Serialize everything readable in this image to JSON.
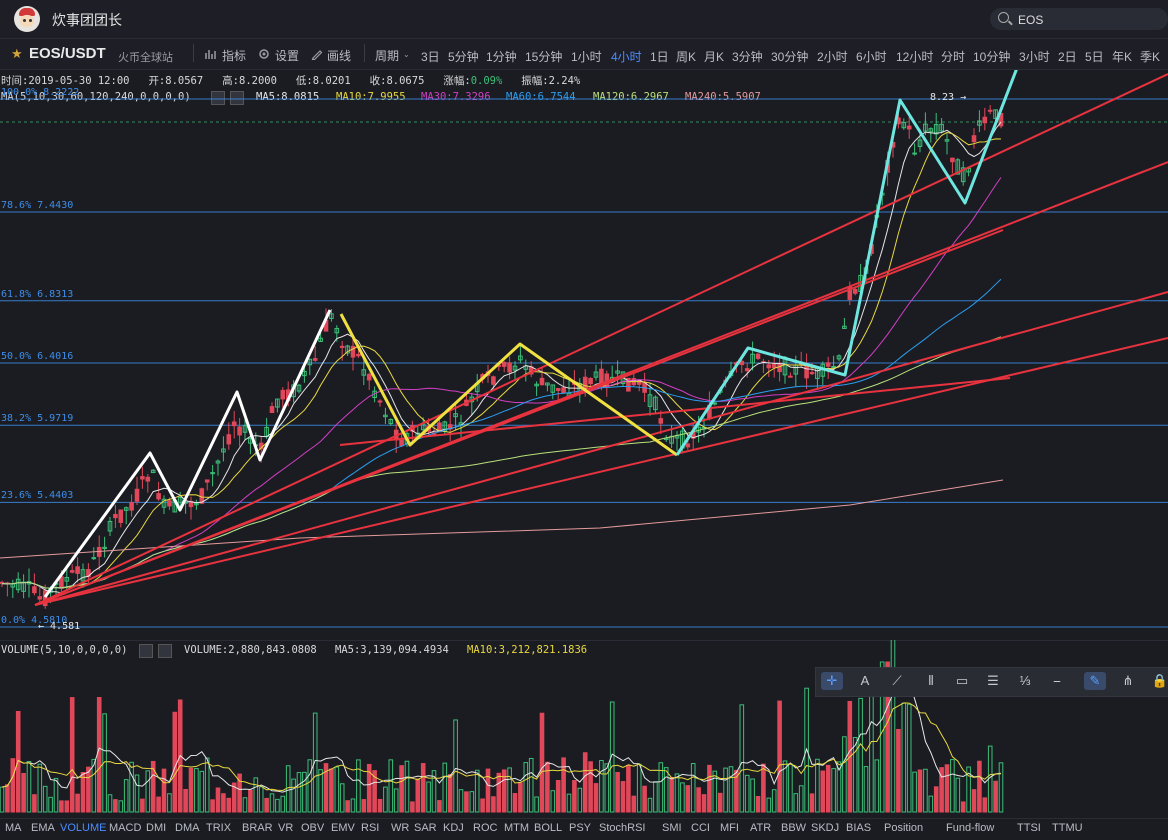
{
  "app": {
    "title": "炊事团团长"
  },
  "search": {
    "value": "EOS"
  },
  "toolbar": {
    "pair": "EOS/USDT",
    "exchange": "火币全球站",
    "indicator_label": "指标",
    "settings_label": "设置",
    "draw_label": "画线",
    "period_label": "周期",
    "periods": [
      "3日",
      "5分钟",
      "1分钟",
      "15分钟",
      "1小时",
      "4小时",
      "1日",
      "周K",
      "月K",
      "3分钟",
      "30分钟",
      "2小时",
      "6小时",
      "12小时",
      "分时",
      "10分钟",
      "3小时",
      "2日",
      "5日",
      "年K",
      "季K"
    ],
    "active_period": "4小时"
  },
  "ohlc": {
    "time_label": "时间:2019-05-30 12:00",
    "open_label": "开:8.0567",
    "high_label": "高:8.2000",
    "low_label": "低:8.0201",
    "close_label": "收:8.0675",
    "change_label": "涨幅:",
    "change_value": "0.09%",
    "amplitude_label": "振幅:2.24%"
  },
  "ma": {
    "params": "MA(5,10,30,60,120,240,0,0,0,0)",
    "ma5": "MA5:8.0815",
    "ma10": "MA10:7.9955",
    "ma30": "MA30:7.3296",
    "ma60": "MA60:6.7544",
    "ma120": "MA120:6.2967",
    "ma240": "MA240:5.5907"
  },
  "fib": [
    {
      "label": "100.0% 8.2222",
      "price": 8.2222
    },
    {
      "label": "78.6% 7.4430",
      "price": 7.443
    },
    {
      "label": "61.8% 6.8313",
      "price": 6.8313
    },
    {
      "label": "50.0% 6.4016",
      "price": 6.4016
    },
    {
      "label": "38.2% 5.9719",
      "price": 5.9719
    },
    {
      "label": "23.6% 5.4403",
      "price": 5.4403
    },
    {
      "label": "0.0% 4.5810",
      "price": 4.581
    }
  ],
  "markers": {
    "high": "8.23 →",
    "low": "← 4.581"
  },
  "volume": {
    "params": "VOLUME(5,10,0,0,0,0)",
    "value": "VOLUME:2,880,843.0808",
    "ma5": "MA5:3,139,094.4934",
    "ma10": "MA10:3,212,821.1836"
  },
  "indicators": [
    "MA",
    "EMA",
    "VOLUME",
    "MACD",
    "DMI",
    "DMA",
    "TRIX",
    "BRAR",
    "VR",
    "OBV",
    "EMV",
    "RSI",
    "WR",
    "SAR",
    "KDJ",
    "ROC",
    "MTM",
    "BOLL",
    "PSY",
    "StochRSI",
    "SMI",
    "CCI",
    "MFI",
    "ATR",
    "BBW",
    "SKDJ",
    "BIAS",
    "Position",
    "Fund-flow",
    "TTSI",
    "TTMU"
  ],
  "active_indicator": "VOLUME",
  "draw_tools": [
    "crosshair-icon",
    "text-icon",
    "line-icon",
    "parallel-icon",
    "rect-icon",
    "fib-icon",
    "measure-icon",
    "ruler-icon",
    "pen-icon",
    "pattern-icon",
    "lock-icon"
  ],
  "colors": {
    "up": "#3bbf78",
    "down": "#e0485a",
    "fib": "#3d8ee8",
    "trend": "#e8333f",
    "ma5": "#e6e6e6",
    "ma10": "#e8d840",
    "ma30": "#d23fc4",
    "ma60": "#2a9ef0",
    "ma120": "#b9e07a",
    "ma240": "#e49a9a",
    "wave_white": "#ffffff",
    "wave_yellow": "#f0e040",
    "wave_cyan": "#6ee6e0"
  },
  "chart_data": {
    "type": "candlestick",
    "y_range": [
      4.5,
      8.5
    ],
    "fib_levels": [
      8.2222,
      7.443,
      6.8313,
      6.4016,
      5.9719,
      5.4403,
      4.581
    ]
  }
}
